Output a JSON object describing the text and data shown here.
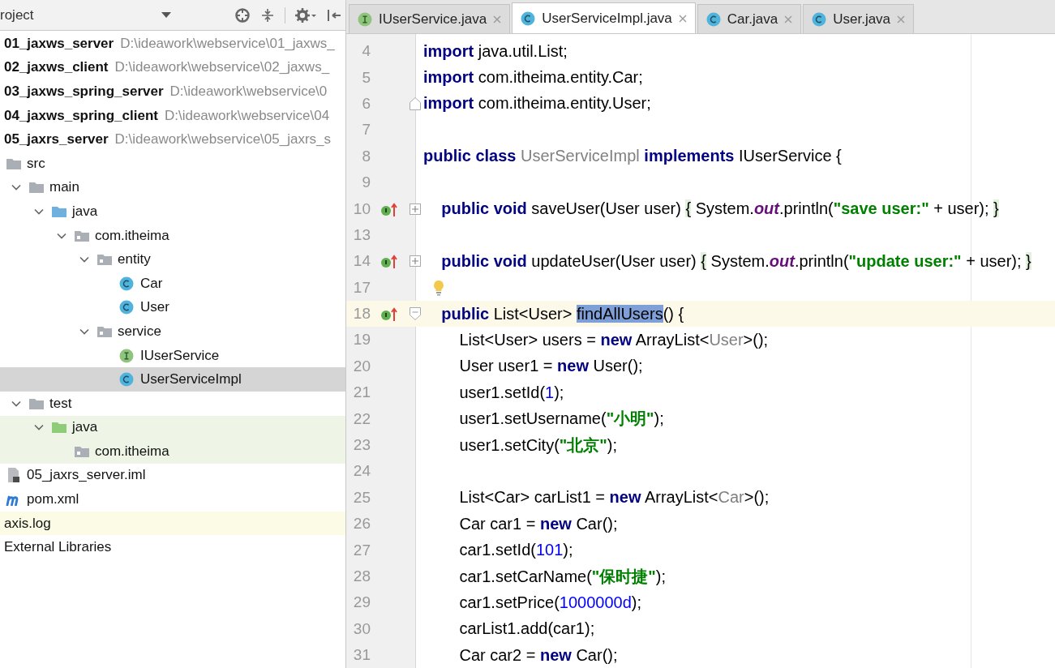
{
  "project_panel": {
    "title": "roject",
    "tree": [
      {
        "label": "01_jaxws_server",
        "path": "D:\\ideawork\\webservice\\01_jaxws_",
        "kind": "module",
        "selected": false
      },
      {
        "label": "02_jaxws_client",
        "path": "D:\\ideawork\\webservice\\02_jaxws_",
        "kind": "module",
        "selected": false
      },
      {
        "label": "03_jaxws_spring_server",
        "path": "D:\\ideawork\\webservice\\0",
        "kind": "module",
        "selected": false
      },
      {
        "label": "04_jaxws_spring_client",
        "path": "D:\\ideawork\\webservice\\04",
        "kind": "module",
        "selected": false
      },
      {
        "label": "05_jaxrs_server",
        "path": "D:\\ideawork\\webservice\\05_jaxrs_s",
        "kind": "module",
        "selected": false,
        "children": [
          {
            "label": "src",
            "kind": "folder",
            "selected": false,
            "children": [
              {
                "label": "main",
                "kind": "folder",
                "expanded": true,
                "selected": false,
                "children": [
                  {
                    "label": "java",
                    "kind": "source-root",
                    "expanded": true,
                    "selected": false,
                    "children": [
                      {
                        "label": "com.itheima",
                        "kind": "package",
                        "expanded": true,
                        "selected": false,
                        "children": [
                          {
                            "label": "entity",
                            "kind": "package",
                            "expanded": true,
                            "selected": false,
                            "children": [
                              {
                                "label": "Car",
                                "kind": "class",
                                "selected": false
                              },
                              {
                                "label": "User",
                                "kind": "class",
                                "selected": false
                              }
                            ]
                          },
                          {
                            "label": "service",
                            "kind": "package",
                            "expanded": true,
                            "selected": false,
                            "children": [
                              {
                                "label": "IUserService",
                                "kind": "interface",
                                "selected": false
                              },
                              {
                                "label": "UserServiceImpl",
                                "kind": "class",
                                "selected": true
                              }
                            ]
                          }
                        ]
                      }
                    ]
                  }
                ]
              },
              {
                "label": "test",
                "kind": "folder",
                "expanded": true,
                "selected": false,
                "children": [
                  {
                    "label": "java",
                    "kind": "test-root",
                    "expanded": true,
                    "selected": false,
                    "color": "#eef5e6",
                    "children": [
                      {
                        "label": "com.itheima",
                        "kind": "package",
                        "selected": false,
                        "color": "#eef5e6"
                      }
                    ]
                  }
                ]
              }
            ]
          },
          {
            "label": "05_jaxrs_server.iml",
            "kind": "iml",
            "selected": false
          },
          {
            "label": "pom.xml",
            "kind": "maven",
            "selected": false
          }
        ]
      },
      {
        "label": "axis.log",
        "kind": "file",
        "selected": false,
        "color": "#fbfbe6"
      },
      {
        "label": "External Libraries",
        "kind": "library",
        "selected": false
      }
    ]
  },
  "editor": {
    "tabs": [
      {
        "label": "IUserService.java",
        "kind": "interface",
        "selected": false
      },
      {
        "label": "UserServiceImpl.java",
        "kind": "class",
        "selected": true
      },
      {
        "label": "Car.java",
        "kind": "class",
        "selected": false
      },
      {
        "label": "User.java",
        "kind": "class",
        "selected": false
      }
    ],
    "lines": [
      {
        "number": "4",
        "kind": "plain",
        "current": false,
        "tokens": [
          {
            "kind": "kw",
            "text": "import"
          },
          {
            "kind": "plain",
            "text": " java.util.List;"
          }
        ]
      },
      {
        "number": "5",
        "kind": "plain",
        "current": false,
        "tokens": [
          {
            "kind": "kw",
            "text": "import"
          },
          {
            "kind": "plain",
            "text": " com.itheima.entity.Car;"
          }
        ]
      },
      {
        "number": "6",
        "kind": "import-end",
        "current": false,
        "tokens": [
          {
            "kind": "kw",
            "text": "import"
          },
          {
            "kind": "plain",
            "text": " com.itheima.entity.User;"
          }
        ]
      },
      {
        "number": "7",
        "kind": "plain",
        "current": false
      },
      {
        "number": "8",
        "kind": "plain",
        "current": false,
        "tokens": [
          {
            "kind": "kw",
            "text": "public class"
          },
          {
            "kind": "gray",
            "text": " UserServiceImpl"
          },
          {
            "kind": "kw",
            "text": " implements"
          },
          {
            "kind": "plain",
            "text": " IUserService {"
          }
        ]
      },
      {
        "number": "9",
        "kind": "plain",
        "current": false
      },
      {
        "number": "10",
        "kind": "folded-method",
        "current": false,
        "tokens": [
          {
            "kind": "kw",
            "text": "    public void"
          },
          {
            "kind": "plain",
            "text": " saveUser(User user) "
          },
          {
            "kind": "fold",
            "text": "{"
          },
          {
            "kind": "plain",
            "text": " System."
          },
          {
            "kind": "field",
            "text": "out"
          },
          {
            "kind": "plain",
            "text": ".println("
          },
          {
            "kind": "str",
            "text": "\"save user:\""
          },
          {
            "kind": "plain",
            "text": " + user); "
          },
          {
            "kind": "fold",
            "text": "}"
          }
        ]
      },
      {
        "number": "13",
        "kind": "plain",
        "current": false
      },
      {
        "number": "14",
        "kind": "folded-method",
        "current": false,
        "tokens": [
          {
            "kind": "kw",
            "text": "    public void"
          },
          {
            "kind": "plain",
            "text": " updateUser(User user) "
          },
          {
            "kind": "fold",
            "text": "{"
          },
          {
            "kind": "plain",
            "text": " System."
          },
          {
            "kind": "field",
            "text": "out"
          },
          {
            "kind": "plain",
            "text": ".println("
          },
          {
            "kind": "str",
            "text": "\"update user:\""
          },
          {
            "kind": "plain",
            "text": " + user); "
          },
          {
            "kind": "fold",
            "text": "}"
          }
        ]
      },
      {
        "number": "17",
        "kind": "hint",
        "current": false
      },
      {
        "number": "18",
        "kind": "method",
        "current": true,
        "tokens": [
          {
            "kind": "kw",
            "text": "    public"
          },
          {
            "kind": "plain",
            "text": " List<User> "
          },
          {
            "kind": "sel",
            "text": "findAllUsers"
          },
          {
            "kind": "plain",
            "text": "() {"
          }
        ]
      },
      {
        "number": "19",
        "kind": "plain",
        "current": false,
        "tokens": [
          {
            "kind": "plain",
            "text": "        List<User> users = "
          },
          {
            "kind": "kw",
            "text": "new"
          },
          {
            "kind": "plain",
            "text": " ArrayList<"
          },
          {
            "kind": "gray",
            "text": "User"
          },
          {
            "kind": "plain",
            "text": ">();"
          }
        ]
      },
      {
        "number": "20",
        "kind": "plain",
        "current": false,
        "tokens": [
          {
            "kind": "plain",
            "text": "        User user1 = "
          },
          {
            "kind": "kw",
            "text": "new"
          },
          {
            "kind": "plain",
            "text": " User();"
          }
        ]
      },
      {
        "number": "21",
        "kind": "plain",
        "current": false,
        "tokens": [
          {
            "kind": "plain",
            "text": "        user1.setId("
          },
          {
            "kind": "num",
            "text": "1"
          },
          {
            "kind": "plain",
            "text": ");"
          }
        ]
      },
      {
        "number": "22",
        "kind": "plain",
        "current": false,
        "tokens": [
          {
            "kind": "plain",
            "text": "        user1.setUsername("
          },
          {
            "kind": "str",
            "text": "\"小明\""
          },
          {
            "kind": "plain",
            "text": ");"
          }
        ]
      },
      {
        "number": "23",
        "kind": "plain",
        "current": false,
        "tokens": [
          {
            "kind": "plain",
            "text": "        user1.setCity("
          },
          {
            "kind": "str",
            "text": "\"北京\""
          },
          {
            "kind": "plain",
            "text": ");"
          }
        ]
      },
      {
        "number": "24",
        "kind": "plain",
        "current": false
      },
      {
        "number": "25",
        "kind": "plain",
        "current": false,
        "tokens": [
          {
            "kind": "plain",
            "text": "        List<Car> carList1 = "
          },
          {
            "kind": "kw",
            "text": "new"
          },
          {
            "kind": "plain",
            "text": " ArrayList<"
          },
          {
            "kind": "gray",
            "text": "Car"
          },
          {
            "kind": "plain",
            "text": ">();"
          }
        ]
      },
      {
        "number": "26",
        "kind": "plain",
        "current": false,
        "tokens": [
          {
            "kind": "plain",
            "text": "        Car car1 = "
          },
          {
            "kind": "kw",
            "text": "new"
          },
          {
            "kind": "plain",
            "text": " Car();"
          }
        ]
      },
      {
        "number": "27",
        "kind": "plain",
        "current": false,
        "tokens": [
          {
            "kind": "plain",
            "text": "        car1.setId("
          },
          {
            "kind": "num",
            "text": "101"
          },
          {
            "kind": "plain",
            "text": ");"
          }
        ]
      },
      {
        "number": "28",
        "kind": "plain",
        "current": false,
        "tokens": [
          {
            "kind": "plain",
            "text": "        car1.setCarName("
          },
          {
            "kind": "str",
            "text": "\"保时捷\""
          },
          {
            "kind": "plain",
            "text": ");"
          }
        ]
      },
      {
        "number": "29",
        "kind": "plain",
        "current": false,
        "tokens": [
          {
            "kind": "plain",
            "text": "        car1.setPrice("
          },
          {
            "kind": "num",
            "text": "1000000d"
          },
          {
            "kind": "plain",
            "text": ");"
          }
        ]
      },
      {
        "number": "30",
        "kind": "plain",
        "current": false,
        "tokens": [
          {
            "kind": "plain",
            "text": "        carList1.add(car1);"
          }
        ]
      },
      {
        "number": "31",
        "kind": "plain",
        "current": false,
        "tokens": [
          {
            "kind": "plain",
            "text": "        Car car2 = "
          },
          {
            "kind": "kw",
            "text": "new"
          },
          {
            "kind": "plain",
            "text": " Car();"
          }
        ]
      }
    ]
  }
}
